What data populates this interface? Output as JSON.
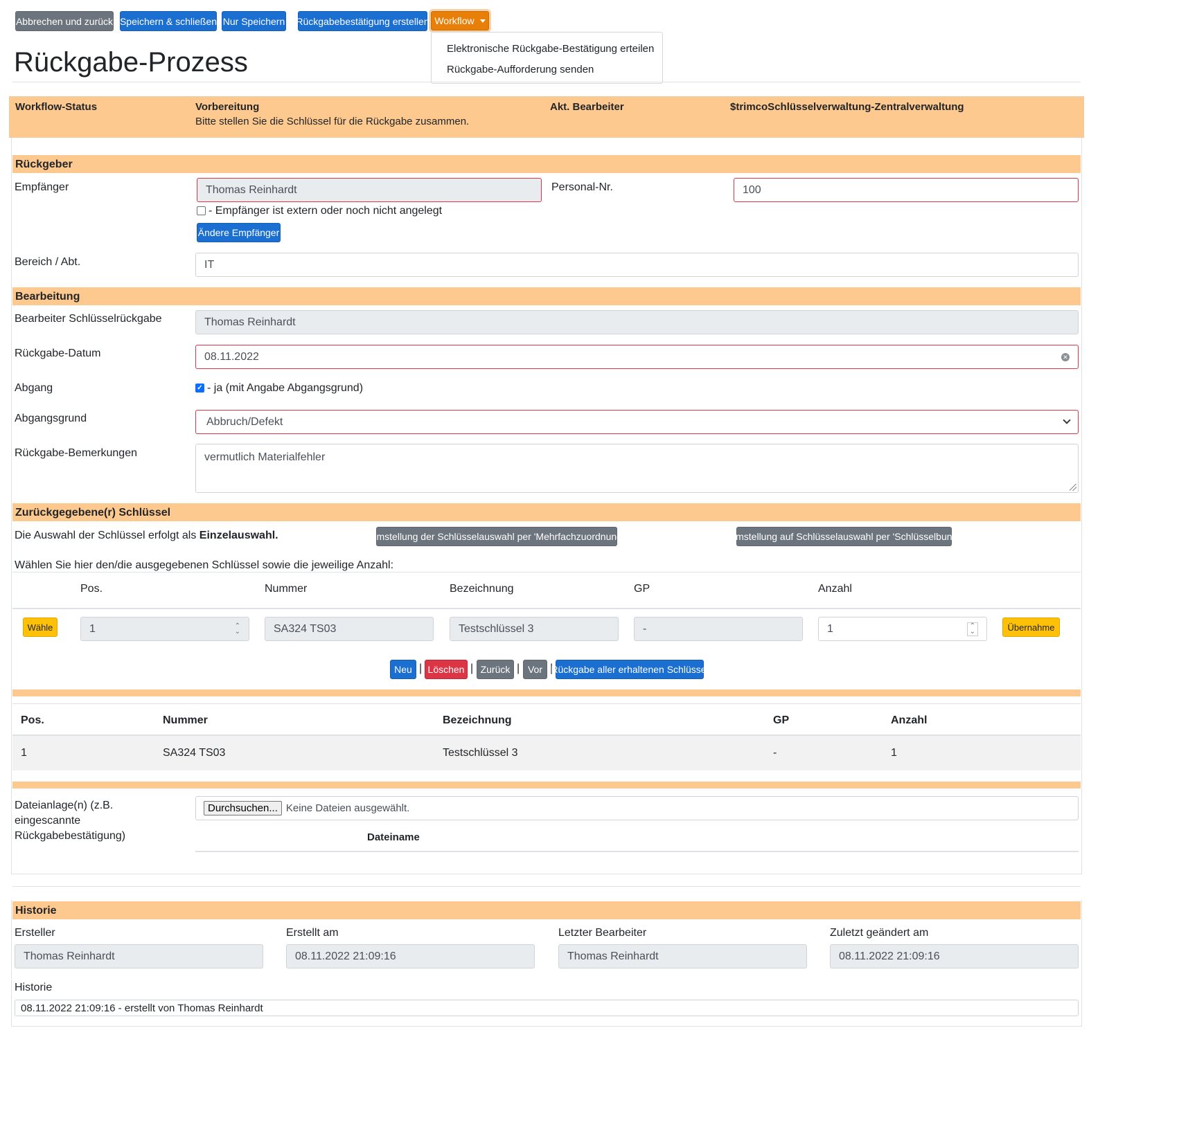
{
  "toolbar": {
    "cancel": "Abbrechen und zurück",
    "save_close": "Speichern & schließen",
    "save_only": "Nur Speichern",
    "create_confirmation": "Rückgabebestätigung erstellen",
    "workflow": "Workflow"
  },
  "workflow_menu": {
    "items": [
      "Elektronische Rückgabe-Bestätigung erteilen",
      "Rückgabe-Aufforderung senden"
    ]
  },
  "page_title": "Rückgabe-Prozess",
  "status_bar": {
    "label": "Workflow-Status",
    "status": "Vorbereitung",
    "status_hint": "Bitte stellen Sie die Schlüssel für die Rückgabe zusammen.",
    "editor_label": "Akt. Bearbeiter",
    "editor": "$trimcoSchlüsselverwaltung-Zentralverwaltung"
  },
  "rueckgeber": {
    "heading": "Rückgeber",
    "recipient_label": "Empfänger",
    "recipient_value": "Thomas Reinhardt",
    "external_checkbox_label": "- Empfänger ist extern oder noch nicht angelegt",
    "change_recipient": "Ändere Empfänger",
    "personnel_label": "Personal-Nr.",
    "personnel_value": "100",
    "department_label": "Bereich / Abt.",
    "department_value": "IT"
  },
  "bearbeitung": {
    "heading": "Bearbeitung",
    "processor_label": "Bearbeiter Schlüsselrückgabe",
    "processor_value": "Thomas Reinhardt",
    "return_date_label": "Rückgabe-Datum",
    "return_date_value": "08.11.2022",
    "disposal_label": "Abgang",
    "disposal_checkbox_label": "- ja (mit Angabe Abgangsgrund)",
    "disposal_reason_label": "Abgangsgrund",
    "disposal_reason_value": "Abbruch/Defekt",
    "remarks_label": "Rückgabe-Bemerkungen",
    "remarks_value": "vermutlich Materialfehler"
  },
  "keys": {
    "heading": "Zurückgegebene(r) Schlüssel",
    "selection_text": "Die Auswahl der Schlüssel erfolgt als ",
    "selection_mode": "Einzelauswahl.",
    "btn_multi": "Umstellung der Schlüsselauswahl per 'Mehrfachzuordnung'",
    "btn_bundle": "Umstellung auf Schlüsselauswahl per 'Schlüsselbund'",
    "instruction": "Wählen Sie hier den/die ausgegebenen Schlüssel sowie die jeweilige Anzahl:",
    "form_headers": {
      "pos": "Pos.",
      "number": "Nummer",
      "designation": "Bezeichnung",
      "gp": "GP",
      "count": "Anzahl"
    },
    "select_btn": "Wähle",
    "form_row": {
      "pos": "1",
      "number": "SA324 TS03",
      "designation": "Testschlüssel 3",
      "gp": "-",
      "count": "1"
    },
    "apply_btn": "Übernahme",
    "nav": {
      "new": "Neu",
      "delete": "Löschen",
      "back": "Zurück",
      "forward": "Vor",
      "return_all": "Rückgabe aller erhaltenen Schlüssel",
      "sep": "|"
    },
    "table_headers": {
      "pos": "Pos.",
      "number": "Nummer",
      "designation": "Bezeichnung",
      "gp": "GP",
      "count": "Anzahl"
    },
    "table_rows": [
      {
        "pos": "1",
        "number": "SA324 TS03",
        "designation": "Testschlüssel 3",
        "gp": "-",
        "count": "1"
      }
    ]
  },
  "attachments": {
    "label": "Dateianlage(n) (z.B. eingescannte Rückgabebestätigung)",
    "browse": "Durchsuchen...",
    "no_file": "Keine Dateien ausgewählt.",
    "filename_header": "Dateiname"
  },
  "history": {
    "heading": "Historie",
    "creator_label": "Ersteller",
    "creator_value": "Thomas Reinhardt",
    "created_label": "Erstellt am",
    "created_value": "08.11.2022 21:09:16",
    "last_editor_label": "Letzter Bearbeiter",
    "last_editor_value": "Thomas Reinhardt",
    "modified_label": "Zuletzt geändert am",
    "modified_value": "08.11.2022 21:09:16",
    "log_label": "Historie",
    "log_value": "08.11.2022 21:09:16 - erstellt von Thomas Reinhardt"
  },
  "colors": {
    "section_bg": "#fec98e",
    "primary": "#0d6efd",
    "secondary": "#6c757d",
    "warning": "#ffc107",
    "danger": "#dc3545",
    "workflow": "#e87f08"
  }
}
